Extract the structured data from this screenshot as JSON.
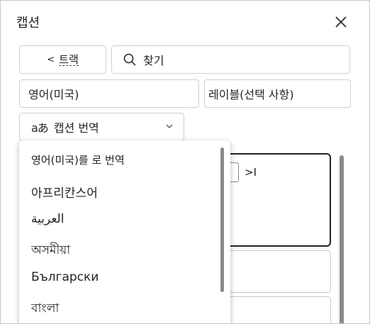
{
  "panel": {
    "title": "캡션"
  },
  "toolbar": {
    "back_label": "트랙",
    "back_chevron": "<"
  },
  "search": {
    "placeholder": "찾기"
  },
  "fields": {
    "language": "영어(미국)",
    "label": "레이블(선택 사항)"
  },
  "translate": {
    "glyph": "aあ",
    "label": "캡션 번역"
  },
  "dropdown": {
    "header": "영어(미국)를 로 번역",
    "options": [
      "아프리칸스어",
      "العربية",
      "অসমীয়া",
      "Български",
      "বাংলা"
    ]
  },
  "card": {
    "skip_glyph": ">I"
  }
}
